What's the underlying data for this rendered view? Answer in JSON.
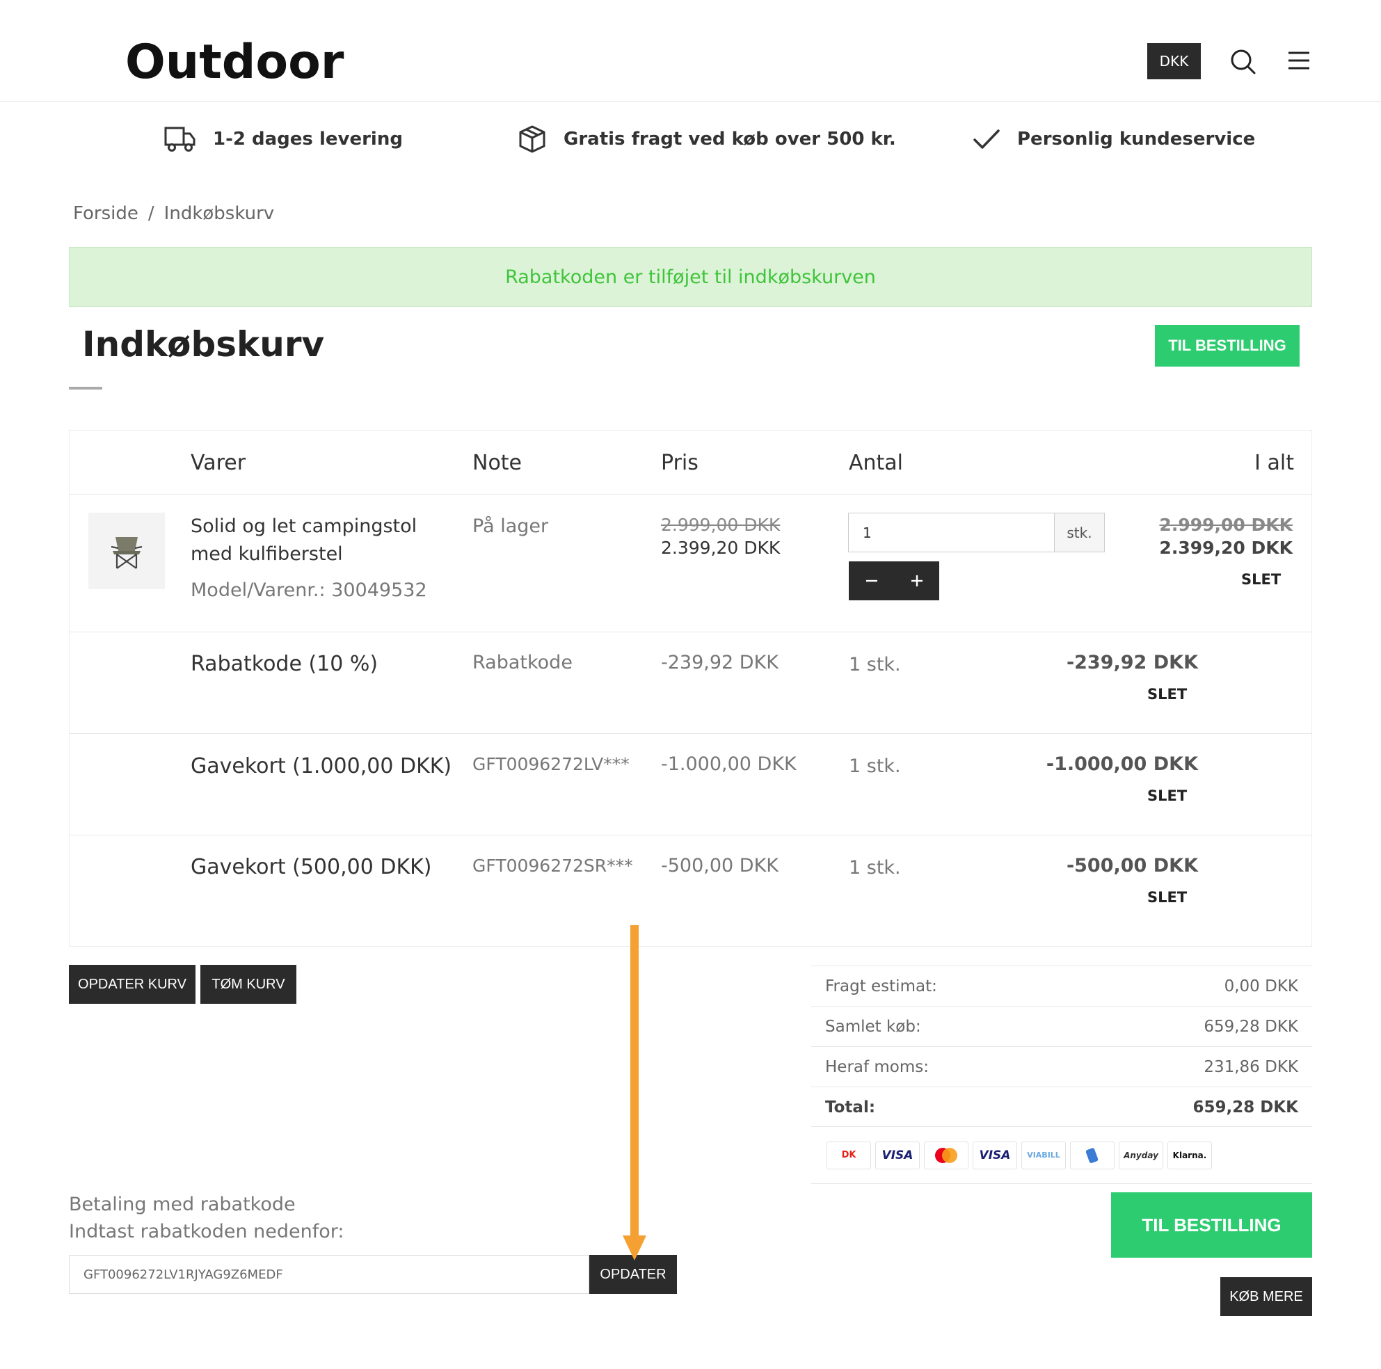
{
  "header": {
    "logo": "Outdoor",
    "currency": "DKK",
    "search_icon": "search-icon",
    "menu_icon": "hamburger-menu-icon"
  },
  "usps": [
    {
      "icon": "truck-icon",
      "label": "1-2 dages levering"
    },
    {
      "icon": "box-icon",
      "label": "Gratis fragt ved køb over 500 kr."
    },
    {
      "icon": "checkmark-icon",
      "label": "Personlig kundeservice"
    }
  ],
  "breadcrumb": {
    "home": "Forside",
    "separator": "/",
    "current": "Indkøbskurv"
  },
  "alert": {
    "message": "Rabatkoden er tilføjet til indkøbskurven",
    "color": "#3fc43a"
  },
  "page": {
    "title": "Indkøbskurv",
    "checkout_top": "TIL BESTILLING"
  },
  "table": {
    "headers": {
      "varer": "Varer",
      "note": "Note",
      "pris": "Pris",
      "antal": "Antal",
      "ialt": "I alt"
    },
    "product": {
      "name_line1": "Solid og let campingstol",
      "name_line2": "med kulfiberstel",
      "model": "Model/Varenr.: 30049532",
      "note": "På lager",
      "price_old": "2.999,00 DKK",
      "price_new": "2.399,20 DKK",
      "qty": "1",
      "unit": "stk.",
      "total_old": "2.999,00 DKK",
      "total_new": "2.399,20 DKK",
      "delete": "SLET"
    },
    "lines": [
      {
        "name": "Rabatkode (10 %)",
        "note": "Rabatkode",
        "price": "-239,92 DKK",
        "qty": "1 stk.",
        "total": "-239,92 DKK",
        "delete": "SLET"
      },
      {
        "name": "Gavekort (1.000,00 DKK)",
        "note": "GFT0096272LV***",
        "price": "-1.000,00 DKK",
        "qty": "1 stk.",
        "total": "-1.000,00 DKK",
        "delete": "SLET"
      },
      {
        "name": "Gavekort (500,00 DKK)",
        "note": "GFT0096272SR***",
        "price": "-500,00 DKK",
        "qty": "1 stk.",
        "total": "-500,00 DKK",
        "delete": "SLET"
      }
    ]
  },
  "actions": {
    "update_cart": "OPDATER KURV",
    "empty_cart": "TØM KURV"
  },
  "totals": {
    "shipping_label": "Fragt estimat:",
    "shipping_value": "0,00 DKK",
    "subtotal_label": "Samlet køb:",
    "subtotal_value": "659,28 DKK",
    "vat_label": "Heraf moms:",
    "vat_value": "231,86 DKK",
    "total_label": "Total:",
    "total_value": "659,28 DKK"
  },
  "payment_methods": [
    {
      "label": "DK",
      "color": "#e2231a"
    },
    {
      "label": "VISA",
      "color": "#1a1f71"
    },
    {
      "label": "",
      "color": "#eb001b"
    },
    {
      "label": "VISA",
      "color": "#1a1f71"
    },
    {
      "label": "VIABILL",
      "color": "#6aa9e0"
    },
    {
      "label": "",
      "color": "#3a7bd5"
    },
    {
      "label": "Anyday",
      "color": "#333333"
    },
    {
      "label": "Klarna.",
      "color": "#111111"
    }
  ],
  "checkout": {
    "button": "TIL BESTILLING",
    "continue": "KØB MERE"
  },
  "coupon": {
    "label1": "Betaling med rabatkode",
    "label2": "Indtast rabatkoden nedenfor:",
    "value": "GFT0096272LV1RJYAG9Z6MEDF",
    "submit": "OPDATER"
  },
  "colors": {
    "green": "#2ecc71",
    "dark": "#2b2b2b",
    "arrow": "#f5a033"
  }
}
